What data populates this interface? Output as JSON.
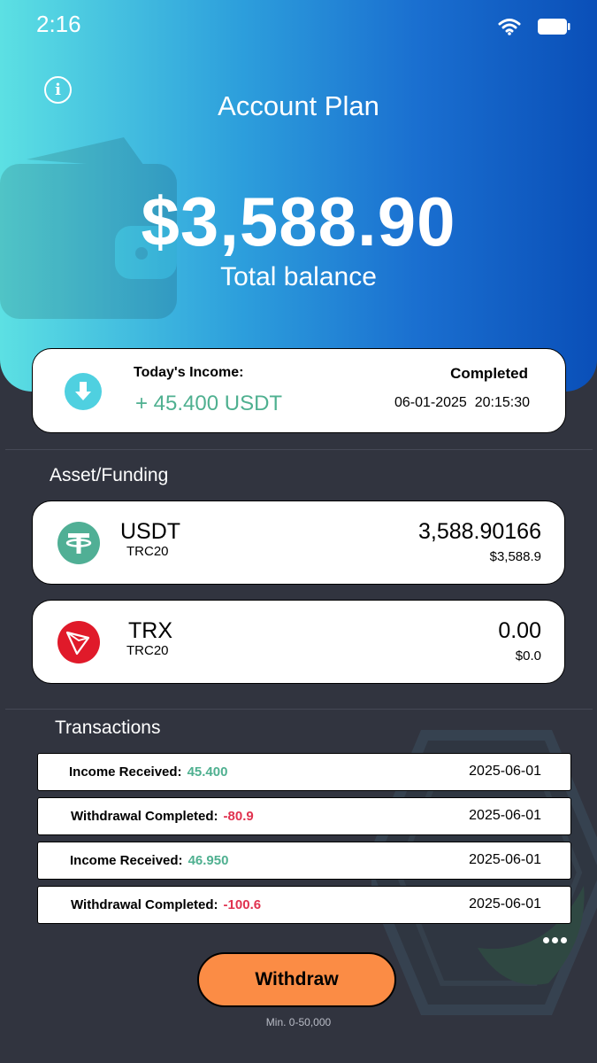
{
  "status_bar": {
    "time": "2:16",
    "icons": [
      "wifi-icon",
      "battery-icon"
    ]
  },
  "header": {
    "info_icon": "info-icon",
    "title": "Account Plan",
    "balance": "$3,588.90",
    "balance_label": "Total balance"
  },
  "income": {
    "label": "Today's Income:",
    "amount": "+ 45.400 USDT",
    "status": "Completed",
    "datetime": "06-01-2025  20:15:30",
    "icon": "download-arrow-icon"
  },
  "assets": {
    "title": "Asset/Funding",
    "items": [
      {
        "name": "USDT",
        "network": "TRC20",
        "amount": "3,588.90166",
        "usd": "$3,588.9",
        "icon": "tether-icon"
      },
      {
        "name": "TRX",
        "network": "TRC20",
        "amount": "0.00",
        "usd": "$0.0",
        "icon": "tron-icon"
      }
    ]
  },
  "transactions": {
    "title": "Transactions",
    "items": [
      {
        "label": "Income Received:",
        "value": "45.400",
        "date": "2025-06-01",
        "type": "income"
      },
      {
        "label": "Withdrawal Completed:",
        "value": "-80.9",
        "date": "2025-06-01",
        "type": "withdrawal"
      },
      {
        "label": "Income Received:",
        "value": "46.950",
        "date": "2025-06-01",
        "type": "income"
      },
      {
        "label": "Withdrawal Completed:",
        "value": "-100.6",
        "date": "2025-06-01",
        "type": "withdrawal"
      }
    ],
    "more_icon": "more-dots-icon"
  },
  "withdraw": {
    "label": "Withdraw",
    "note": "Min. 0-50,000"
  },
  "colors": {
    "income": "#4fb090",
    "withdrawal": "#e0324f",
    "accent_button": "#fb8c45",
    "background": "#31343f"
  }
}
